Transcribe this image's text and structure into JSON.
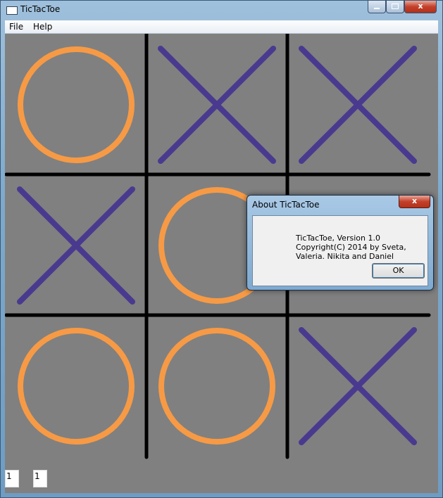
{
  "window": {
    "title": "TicTacToe",
    "controls": {
      "minimize": "",
      "maximize": "",
      "close": "x"
    }
  },
  "menu": {
    "items": [
      "File",
      "Help"
    ]
  },
  "board": {
    "cells": [
      "O",
      "X",
      "X",
      "X",
      "O",
      "",
      "O",
      "O",
      "X"
    ],
    "colors": {
      "o": "#f79a45",
      "x": "#4a3a8f",
      "grid": "#000000",
      "background": "#808080"
    }
  },
  "score": {
    "left": "1",
    "right": "1"
  },
  "dialog": {
    "title": "About TicTacToe",
    "close": "x",
    "lines": [
      "TicTacToe, Version 1.0",
      "Copyright(C) 2014 by Sveta,",
      "Valeria. Nikita and Daniel"
    ],
    "ok_label": "OK"
  }
}
